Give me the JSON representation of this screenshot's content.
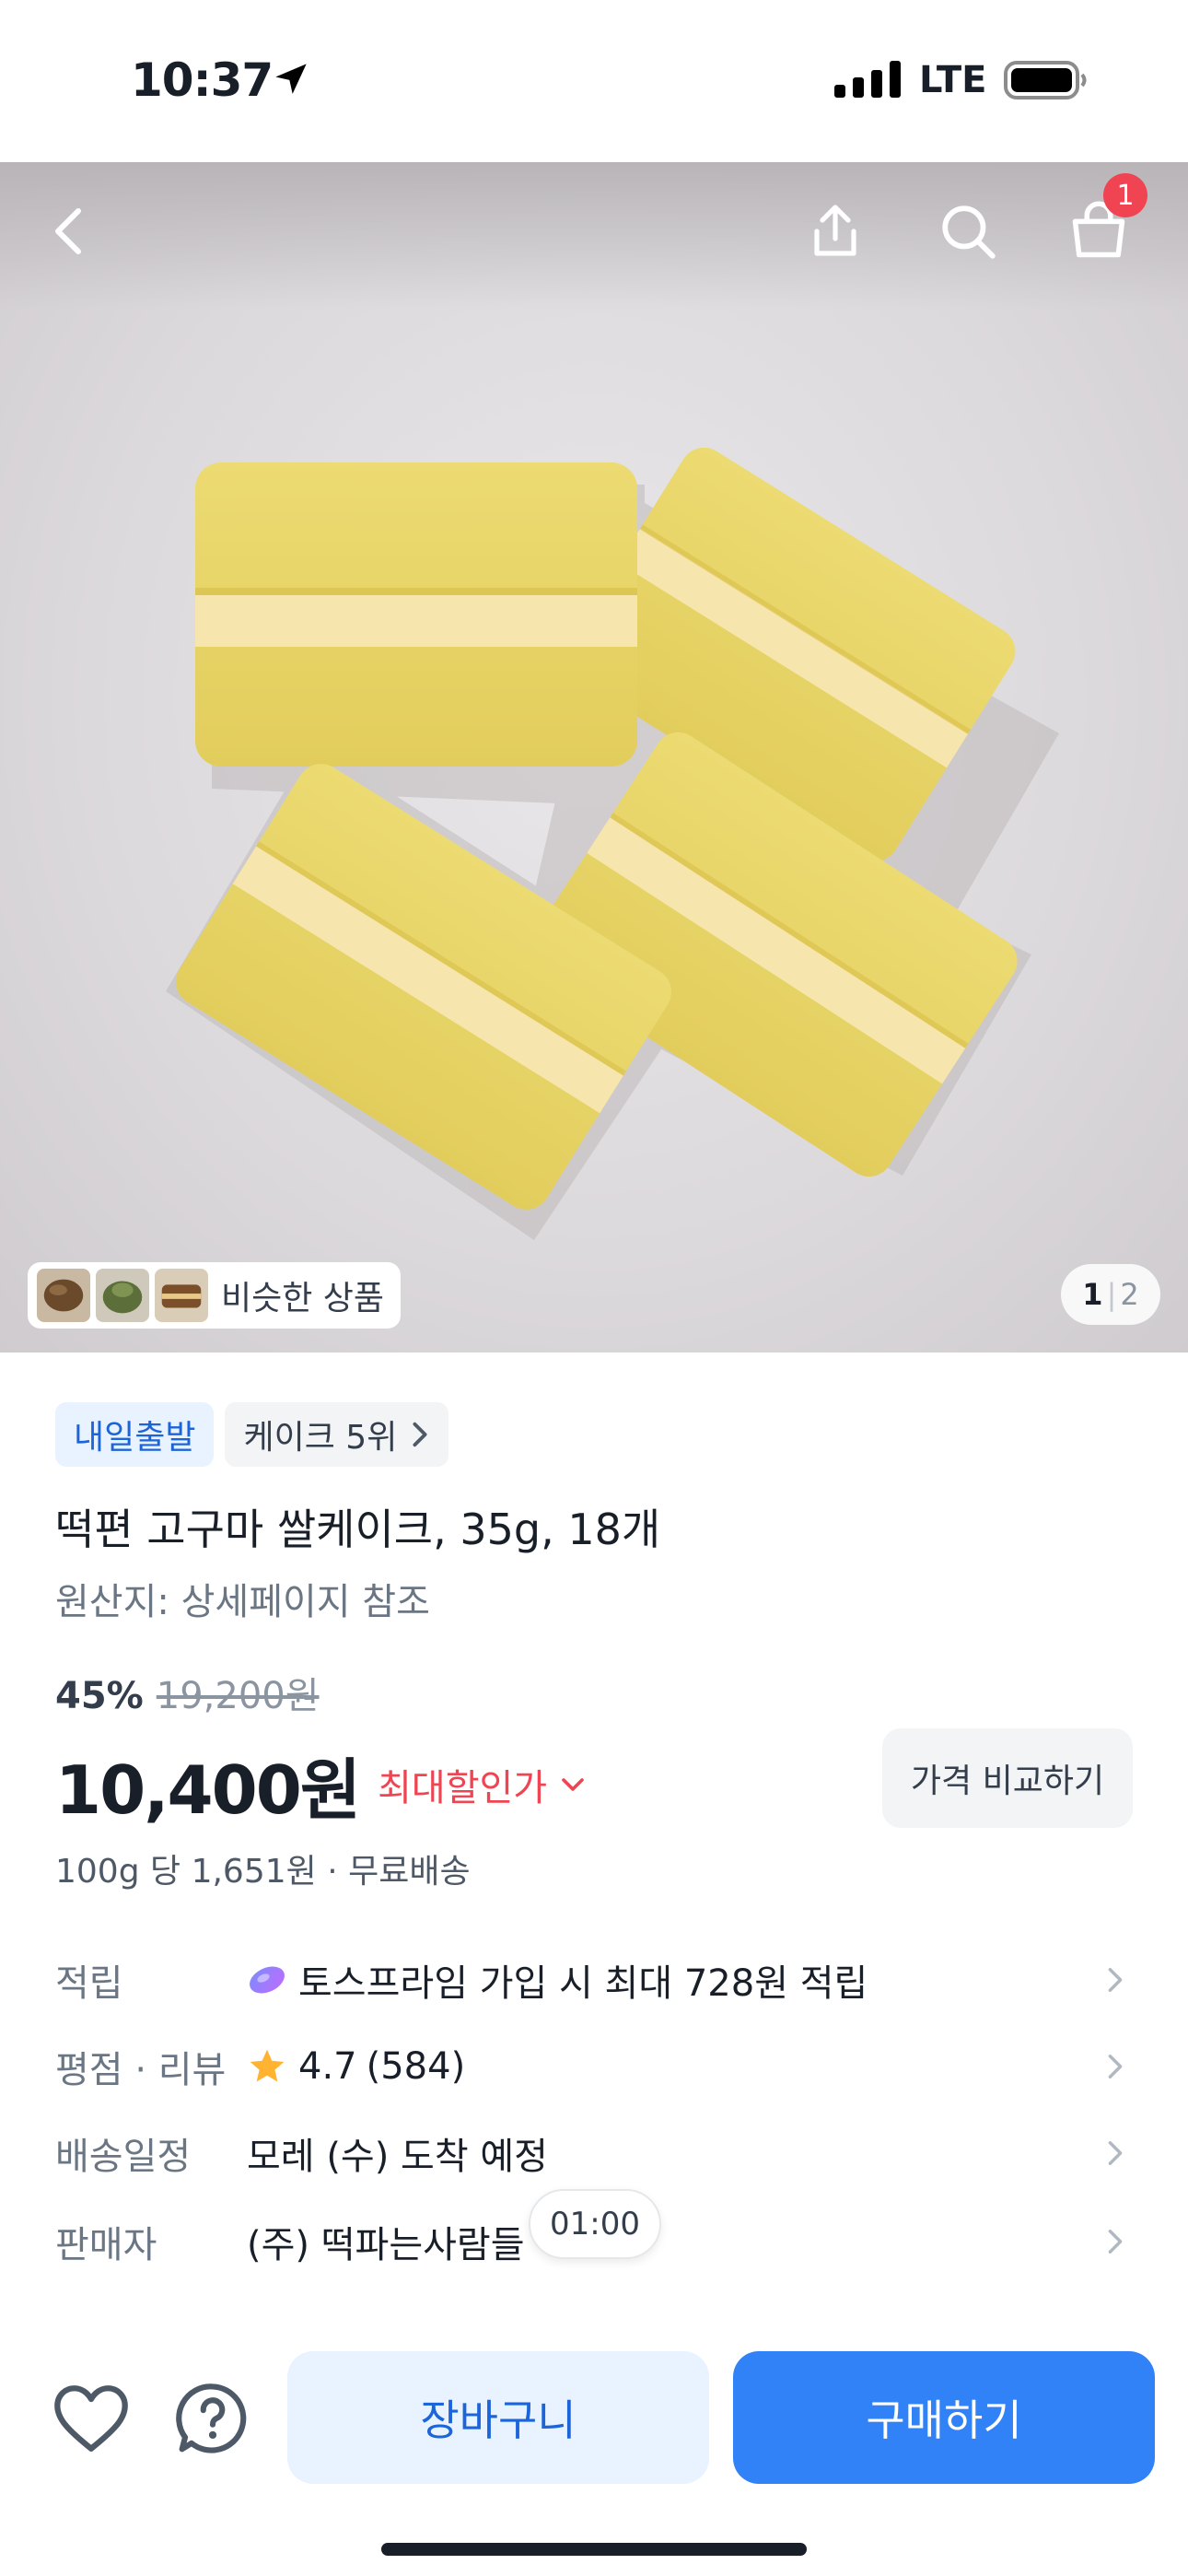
{
  "status_bar": {
    "time": "10:37",
    "network": "LTE"
  },
  "header": {
    "cart_count": "1"
  },
  "hero": {
    "similar_label": "비슷한 상품",
    "page_current": "1",
    "page_total": "2"
  },
  "product": {
    "tags": [
      {
        "label": "내일출발"
      },
      {
        "label": "케이크 5위"
      }
    ],
    "title": "떡편 고구마 쌀케이크, 35g, 18개",
    "origin": "원산지: 상세페이지 참조",
    "discount_rate": "45%",
    "original_price": "19,200원",
    "price": "10,400원",
    "max_discount_label": "최대할인가",
    "compare_label": "가격 비교하기",
    "unit_info": "100g 당 1,651원 · 무료배송"
  },
  "info_rows": [
    {
      "label": "적립",
      "value": "토스프라임 가입 시 최대 728원 적립"
    },
    {
      "label": "평점 · 리뷰",
      "rating": "4.7",
      "reviews": "(584)"
    },
    {
      "label": "배송일정",
      "value": "모레 (수) 도착 예정"
    },
    {
      "label": "판매자",
      "value": "(주) 떡파는사람들"
    }
  ],
  "timer": "01:00",
  "bottom": {
    "cart_label": "장바구니",
    "buy_label": "구매하기"
  },
  "colors": {
    "accent": "#3182f6",
    "sale": "#f04452",
    "tag_blue": "#1b64da",
    "star": "#ffb331"
  }
}
